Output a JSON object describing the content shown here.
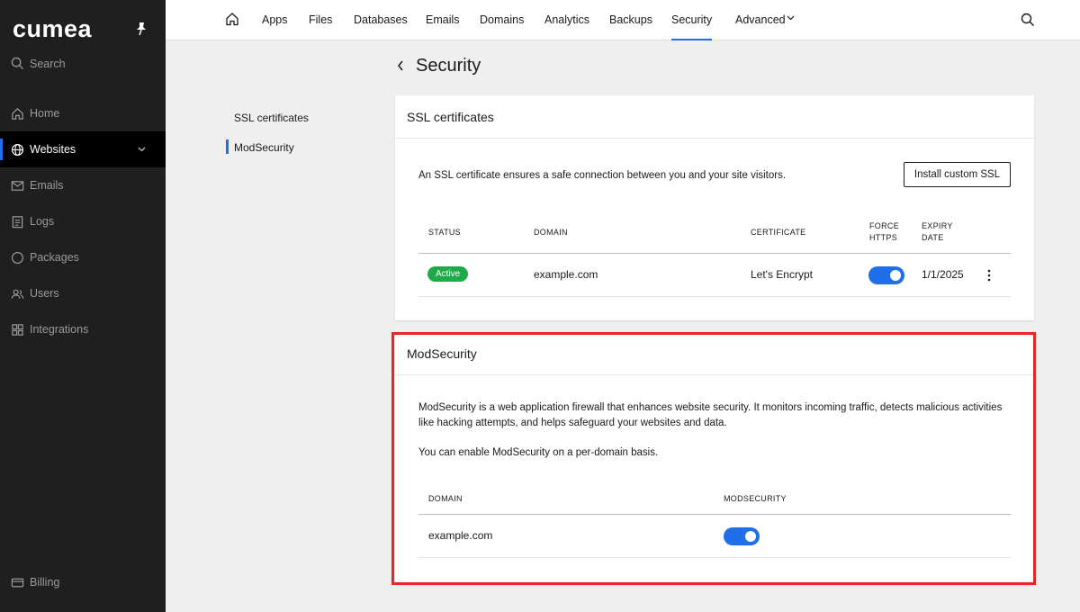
{
  "sidebar": {
    "logo": "cumea",
    "search_label": "Search",
    "items": [
      {
        "label": "Home",
        "icon": "home-icon"
      },
      {
        "label": "Websites",
        "icon": "globe-icon",
        "active": true
      },
      {
        "label": "Emails",
        "icon": "mail-icon"
      },
      {
        "label": "Logs",
        "icon": "logs-icon"
      },
      {
        "label": "Packages",
        "icon": "package-icon"
      },
      {
        "label": "Users",
        "icon": "users-icon"
      },
      {
        "label": "Integrations",
        "icon": "grid-icon"
      }
    ],
    "billing_label": "Billing"
  },
  "topnav": {
    "tabs": [
      "Apps",
      "Files",
      "Databases",
      "Emails",
      "Domains",
      "Analytics",
      "Backups",
      "Security",
      "Advanced"
    ],
    "active_tab": "Security"
  },
  "page": {
    "title": "Security"
  },
  "subnav": {
    "items": [
      "SSL certificates",
      "ModSecurity"
    ],
    "active": "ModSecurity"
  },
  "ssl": {
    "title": "SSL certificates",
    "description": "An SSL certificate ensures a safe connection between you and your site visitors.",
    "install_button": "Install custom SSL",
    "columns": {
      "status": "STATUS",
      "domain": "DOMAIN",
      "certificate": "CERTIFICATE",
      "force_https_1": "FORCE",
      "force_https_2": "HTTPS",
      "expiry_1": "EXPIRY",
      "expiry_2": "DATE"
    },
    "row": {
      "status": "Active",
      "domain": "example.com",
      "certificate": "Let's Encrypt",
      "force_https": true,
      "expiry": "1/1/2025"
    }
  },
  "modsecurity": {
    "title": "ModSecurity",
    "description_1": "ModSecurity is a web application firewall that enhances website security. It monitors incoming traffic, detects malicious activities",
    "description_2": "like hacking attempts, and helps safeguard your websites and data.",
    "description_3": "You can enable ModSecurity on a per-domain basis.",
    "columns": {
      "domain": "DOMAIN",
      "modsecurity": "MODSECURITY"
    },
    "row": {
      "domain": "example.com",
      "enabled": true
    }
  },
  "colors": {
    "accent": "#1f6fea",
    "active_badge": "#1faa4a",
    "highlight": "#e8281f",
    "sidebar_bg": "#1f1f1f"
  }
}
